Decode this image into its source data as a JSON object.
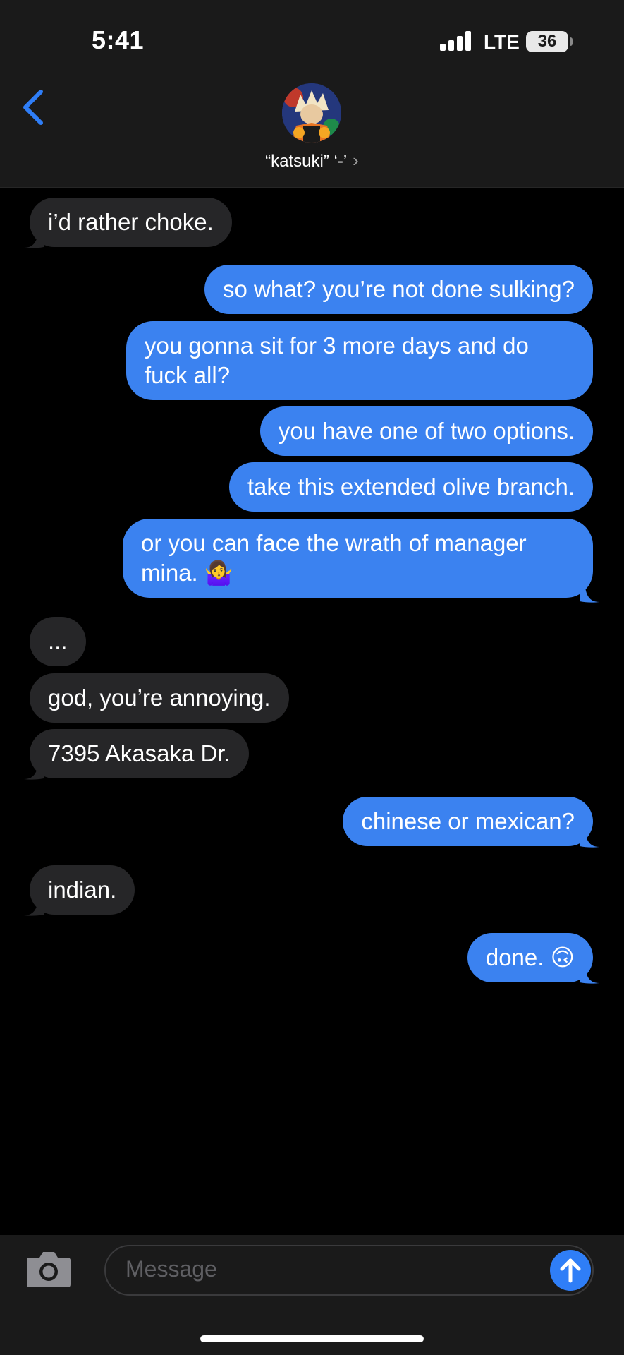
{
  "status_bar": {
    "time": "5:41",
    "network": "LTE",
    "battery": "36"
  },
  "header": {
    "contact_name": "“katsuki” ‘-’",
    "chevron": "›",
    "back_icon": "chevron-left-icon"
  },
  "messages": [
    {
      "side": "received",
      "text": "i’d rather choke."
    },
    {
      "side": "sent",
      "text": "so what? you’re not done sulking?"
    },
    {
      "side": "sent",
      "text": "you gonna sit for 3 more days and do fuck all?"
    },
    {
      "side": "sent",
      "text": "you have one of two options."
    },
    {
      "side": "sent",
      "text": "take this extended olive branch."
    },
    {
      "side": "sent",
      "text": "or you can face the wrath of manager mina. 🤷‍♀️"
    },
    {
      "side": "received",
      "text": "..."
    },
    {
      "side": "received",
      "text": "god, you’re annoying."
    },
    {
      "side": "received",
      "text": "7395 Akasaka Dr."
    },
    {
      "side": "sent",
      "text": "chinese or mexican?"
    },
    {
      "side": "received",
      "text": "indian."
    },
    {
      "side": "sent",
      "text": "done. 🙃"
    }
  ],
  "composer": {
    "placeholder": "Message",
    "camera_icon": "camera-icon",
    "send_icon": "arrow-up-icon"
  },
  "colors": {
    "sent_bubble": "#3b82f0",
    "received_bubble": "#262628",
    "accent": "#2f7ef7"
  }
}
